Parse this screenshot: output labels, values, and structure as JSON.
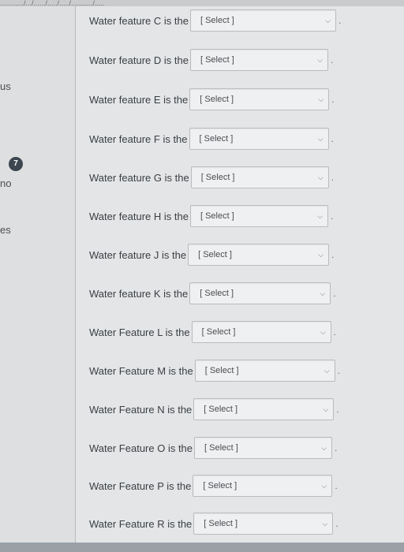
{
  "top_fragment": "............/.../....../...../...../.........../.....",
  "left_fragments": {
    "us": "us",
    "badge": "7",
    "no": "no",
    "es": "es"
  },
  "select_placeholder": "[ Select ]",
  "rows": [
    {
      "label": "Water feature C is the",
      "value": "[ Select ]"
    },
    {
      "label": "Water feature D is the",
      "value": "[ Select ]"
    },
    {
      "label": "Water feature E is the",
      "value": "[ Select ]"
    },
    {
      "label": "Water feature F is the",
      "value": "[ Select ]"
    },
    {
      "label": "Water feature G is the",
      "value": "[ Select ]"
    },
    {
      "label": "Water feature H is the",
      "value": "[ Select ]"
    },
    {
      "label": "Water feature J is the",
      "value": "[ Select ]"
    },
    {
      "label": "Water feature K is the",
      "value": "[ Select ]"
    },
    {
      "label": "Water Feature L is the",
      "value": "[ Select ]"
    },
    {
      "label": "Water Feature M is the",
      "value": "[ Select ]"
    },
    {
      "label": "Water Feature N is the",
      "value": "[ Select ]"
    },
    {
      "label": "Water Feature O is the",
      "value": "[ Select ]"
    },
    {
      "label": "Water Feature P is the",
      "value": "[ Select ]"
    },
    {
      "label": "Water Feature R is the",
      "value": "[ Select ]"
    }
  ],
  "chevron_icon": "chevron-down-icon",
  "colors": {
    "main_bg": "#e4e5e6",
    "sidebar_bg": "#dedfe0",
    "select_bg": "#eff0f1",
    "badge_bg": "#3d4650",
    "text": "#3a3f44"
  }
}
